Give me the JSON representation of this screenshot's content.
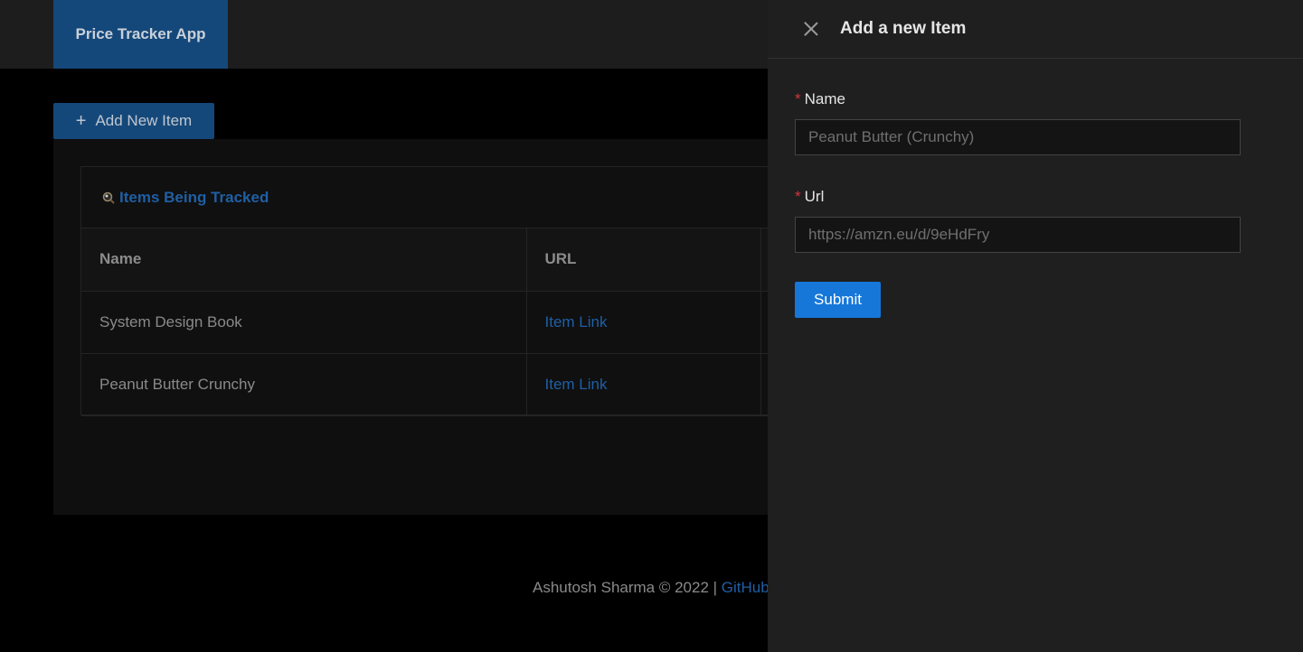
{
  "header": {
    "brand": "Price Tracker App"
  },
  "toolbar": {
    "add_label": "Add New Item",
    "add_icon": "plus-icon"
  },
  "card": {
    "title": "Items Being Tracked",
    "title_icon": "magnifier-icon"
  },
  "table": {
    "columns": [
      "Name",
      "URL"
    ],
    "rows": [
      {
        "name": "System Design Book",
        "url": "Item Link"
      },
      {
        "name": "Peanut Butter Crunchy",
        "url": "Item Link"
      }
    ]
  },
  "footer": {
    "text": "Ashutosh Sharma © 2022 | ",
    "link": "GitHub"
  },
  "drawer": {
    "title": "Add a new Item",
    "fields": [
      {
        "label": "Name",
        "placeholder": "Peanut Butter (Crunchy)"
      },
      {
        "label": "Url",
        "placeholder": "https://amzn.eu/d/9eHdFry"
      }
    ],
    "submit_label": "Submit"
  },
  "colors": {
    "brand": "#15487a",
    "link": "#1f5fa5",
    "primary": "#1677d9",
    "required": "#d13438"
  }
}
